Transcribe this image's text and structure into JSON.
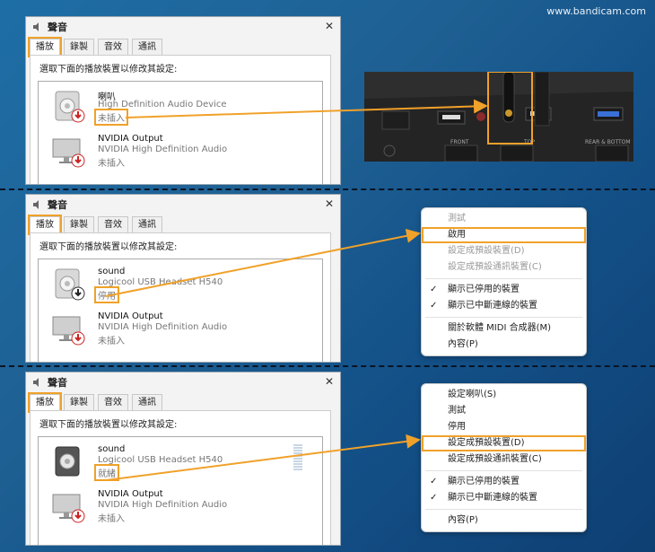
{
  "watermark": "www.bandicam.com",
  "colors": {
    "accent": "#f0a12a"
  },
  "panels": [
    {
      "title": "聲音",
      "close_label": "✕",
      "tabs": [
        "播放",
        "錄製",
        "音效",
        "通訊"
      ],
      "instruction": "選取下面的播放裝置以修改其設定:",
      "devices": [
        {
          "name": "喇叭",
          "desc": "High Definition Audio Device",
          "state": "未插入",
          "icon": "speaker-icon",
          "badge": "unplugged"
        },
        {
          "name": "NVIDIA Output",
          "desc": "NVIDIA High Definition Audio",
          "state": "未插入",
          "icon": "monitor-icon",
          "badge": "unplugged"
        }
      ]
    },
    {
      "title": "聲音",
      "close_label": "✕",
      "tabs": [
        "播放",
        "錄製",
        "音效",
        "通訊"
      ],
      "instruction": "選取下面的播放裝置以修改其設定:",
      "devices": [
        {
          "name": "sound",
          "desc": "Logicool USB Headset H540",
          "state": "停用",
          "icon": "speaker-icon",
          "badge": "disabled"
        },
        {
          "name": "NVIDIA Output",
          "desc": "NVIDIA High Definition Audio",
          "state": "未插入",
          "icon": "monitor-icon",
          "badge": "unplugged"
        }
      ]
    },
    {
      "title": "聲音",
      "close_label": "✕",
      "tabs": [
        "播放",
        "錄製",
        "音效",
        "通訊"
      ],
      "instruction": "選取下面的播放裝置以修改其設定:",
      "devices": [
        {
          "name": "sound",
          "desc": "Logicool USB Headset H540",
          "state": "就緒",
          "icon": "speaker-icon",
          "badge": "none"
        },
        {
          "name": "NVIDIA Output",
          "desc": "NVIDIA High Definition Audio",
          "state": "未插入",
          "icon": "monitor-icon",
          "badge": "unplugged"
        }
      ]
    }
  ],
  "photo": {
    "labels": [
      "FRONT",
      "TOP",
      "REAR & BOTTOM"
    ]
  },
  "menus": [
    {
      "items": [
        {
          "label": "測試",
          "disabled": true,
          "checked": false,
          "highlight": false
        },
        {
          "label": "啟用",
          "disabled": false,
          "checked": false,
          "highlight": true
        },
        {
          "label": "設定成預設裝置(D)",
          "disabled": true,
          "checked": false,
          "highlight": false
        },
        {
          "label": "設定成預設通訊裝置(C)",
          "disabled": true,
          "checked": false,
          "highlight": false
        },
        {
          "sep": true
        },
        {
          "label": "顯示已停用的裝置",
          "disabled": false,
          "checked": true,
          "highlight": false
        },
        {
          "label": "顯示已中斷連線的裝置",
          "disabled": false,
          "checked": true,
          "highlight": false
        },
        {
          "sep": true
        },
        {
          "label": "關於軟體 MIDI 合成器(M)",
          "disabled": false,
          "checked": false,
          "highlight": false
        },
        {
          "label": "內容(P)",
          "disabled": false,
          "checked": false,
          "highlight": false
        }
      ]
    },
    {
      "items": [
        {
          "label": "設定喇叭(S)",
          "disabled": false,
          "checked": false,
          "highlight": false
        },
        {
          "label": "測試",
          "disabled": false,
          "checked": false,
          "highlight": false
        },
        {
          "label": "停用",
          "disabled": false,
          "checked": false,
          "highlight": false
        },
        {
          "label": "設定成預設裝置(D)",
          "disabled": false,
          "checked": false,
          "highlight": true
        },
        {
          "label": "設定成預設通訊裝置(C)",
          "disabled": false,
          "checked": false,
          "highlight": false
        },
        {
          "sep": true
        },
        {
          "label": "顯示已停用的裝置",
          "disabled": false,
          "checked": true,
          "highlight": false
        },
        {
          "label": "顯示已中斷連線的裝置",
          "disabled": false,
          "checked": true,
          "highlight": false
        },
        {
          "sep": true
        },
        {
          "label": "內容(P)",
          "disabled": false,
          "checked": false,
          "highlight": false
        }
      ]
    }
  ]
}
